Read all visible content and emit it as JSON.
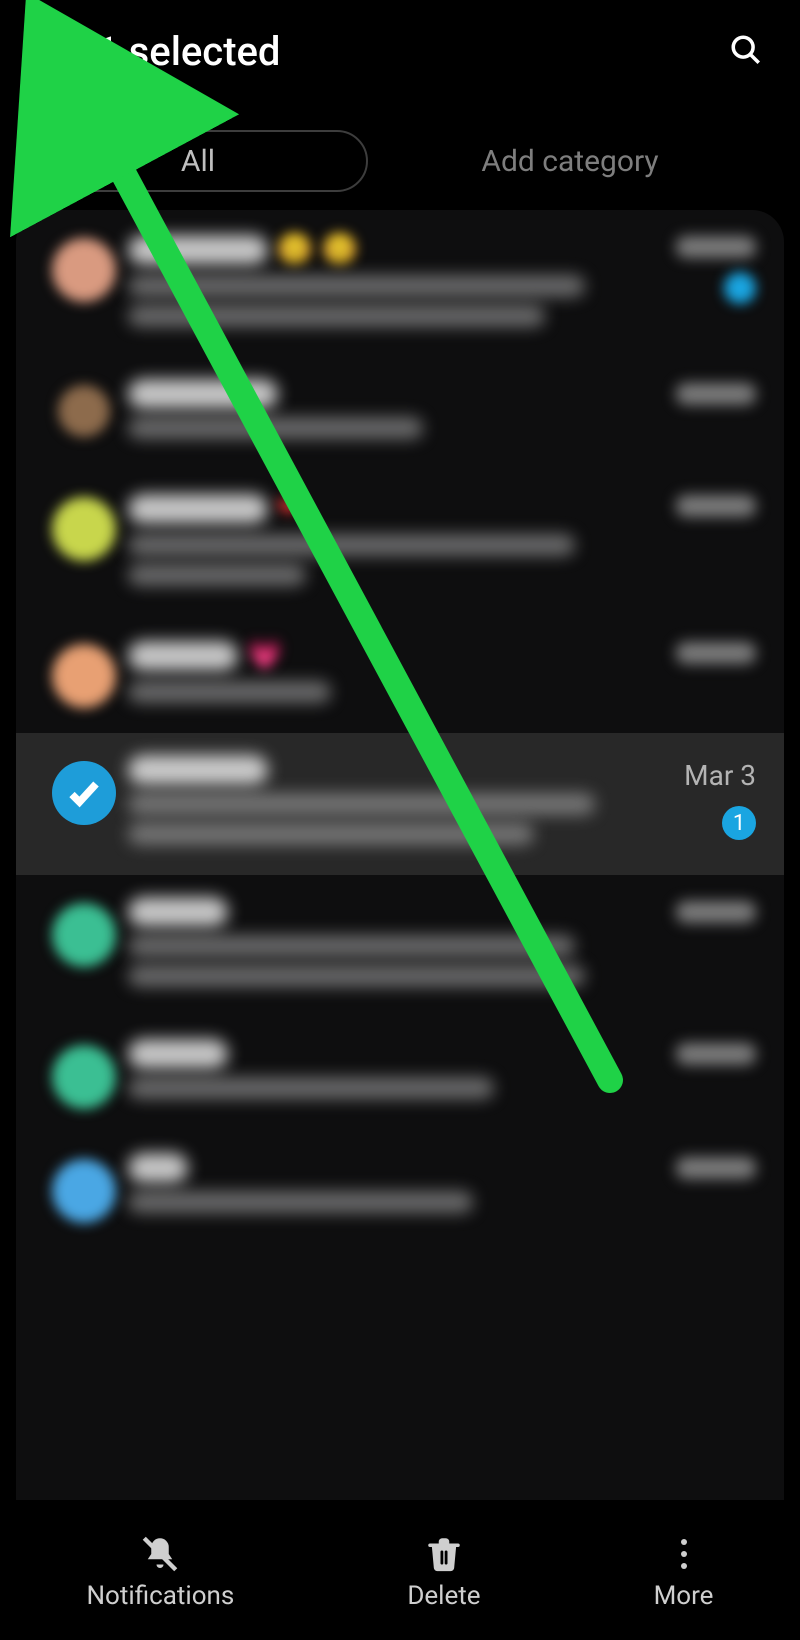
{
  "header": {
    "select_all_label": "All",
    "title": "1 selected"
  },
  "tabs": {
    "all_label": "All",
    "add_category_label": "Add category"
  },
  "conversations": [
    {
      "selected": false,
      "avatar_color": "#d99a80",
      "unread": true,
      "time_visible": false
    },
    {
      "selected": false,
      "avatar_color": "#8d6b4c",
      "unread": false,
      "time_visible": false
    },
    {
      "selected": false,
      "avatar_color": "#c8d64c",
      "unread": false,
      "time_visible": false
    },
    {
      "selected": false,
      "avatar_color": "#e8a073",
      "unread": false,
      "time_visible": false
    },
    {
      "selected": true,
      "avatar_color": "#1e9dd9",
      "unread_count": "1",
      "time": "Mar 3",
      "time_visible": true
    },
    {
      "selected": false,
      "avatar_color": "#3bbf93",
      "unread": false,
      "time_visible": false
    },
    {
      "selected": false,
      "avatar_color": "#3bbf93",
      "unread": false,
      "time_visible": false
    },
    {
      "selected": false,
      "avatar_color": "#4aa7e4",
      "unread": false,
      "time_visible": false
    }
  ],
  "bottom_bar": {
    "notifications": "Notifications",
    "delete": "Delete",
    "more": "More"
  }
}
